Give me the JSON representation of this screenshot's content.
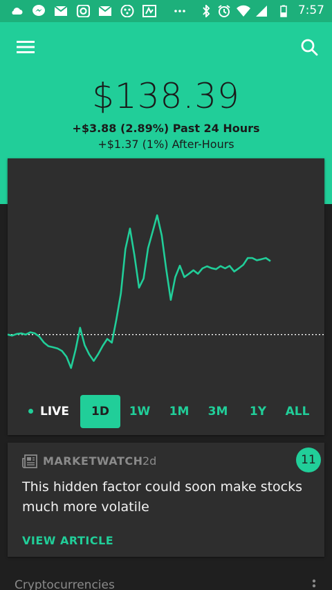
{
  "status_bar": {
    "time": "7:57",
    "icons": [
      "cloud-icon",
      "messenger-icon",
      "mail-icon",
      "instagram-icon",
      "mail-icon",
      "app-icon",
      "app2-icon",
      "more-notifications-icon",
      "bluetooth-icon",
      "alarm-icon",
      "wifi-icon",
      "signal-icon",
      "battery-icon"
    ]
  },
  "header": {
    "price": "$138.39",
    "change": "+$3.88 (2.89%) Past 24 Hours",
    "after_hours": "+$1.37 (1%) After-Hours"
  },
  "chart_data": {
    "type": "line",
    "title": "",
    "xlabel": "",
    "ylabel": "",
    "baseline": 134.51,
    "ylim": [
      132.0,
      142.0
    ],
    "x": [
      0,
      1,
      2,
      3,
      4,
      5,
      6,
      7,
      8,
      9,
      10,
      11,
      12,
      13,
      14,
      15,
      16,
      17,
      18,
      19,
      20,
      21,
      22,
      23,
      24,
      25,
      26,
      27,
      28,
      29,
      30,
      31,
      32,
      33,
      34,
      35,
      36,
      37,
      38,
      39,
      40,
      41,
      42,
      43,
      44,
      45,
      46,
      47,
      48,
      49,
      50,
      51,
      52,
      53,
      54,
      55,
      56,
      57,
      58,
      59,
      60,
      61,
      62,
      63,
      64,
      65,
      66,
      67,
      68,
      69,
      70,
      71,
      72,
      73,
      74,
      75,
      76,
      77,
      78,
      79,
      80,
      81,
      82,
      83,
      84,
      85,
      86,
      87,
      88,
      89,
      90,
      91,
      92,
      93,
      94,
      95,
      96,
      97,
      98,
      99,
      100
    ],
    "values": [
      134.51,
      134.46,
      134.54,
      134.57,
      134.51,
      134.62,
      134.57,
      134.41,
      134.13,
      133.95,
      133.9,
      133.84,
      133.72,
      133.44,
      132.9,
      133.78,
      134.84,
      134.0,
      133.56,
      133.24,
      133.57,
      133.97,
      134.3,
      134.12,
      135.23,
      136.5,
      138.63,
      139.62,
      138.32,
      136.77,
      137.21,
      138.68,
      139.47,
      140.26,
      139.29,
      137.66,
      136.18,
      137.28,
      137.83,
      137.28,
      137.44,
      137.61,
      137.44,
      137.7,
      137.8,
      137.71,
      137.66,
      137.81,
      137.7,
      137.82,
      137.55,
      137.7,
      137.87,
      138.2,
      138.2,
      138.09,
      138.14,
      138.2,
      138.05
    ],
    "color": "#21ce99",
    "baseline_color": "#ffffff"
  },
  "ranges": {
    "live_label": "LIVE",
    "items": [
      {
        "label": "1D",
        "active": true
      },
      {
        "label": "1W",
        "active": false
      },
      {
        "label": "1M",
        "active": false
      },
      {
        "label": "3M",
        "active": false
      },
      {
        "label": "1Y",
        "active": false
      },
      {
        "label": "ALL",
        "active": false
      }
    ]
  },
  "news": {
    "source": "MARKETWATCH",
    "age": "2d",
    "title": "This hidden factor could soon make stocks much more volatile",
    "action": "VIEW ARTICLE",
    "count": "11"
  },
  "next_section": {
    "title": "Cryptocurrencies"
  },
  "colors": {
    "accent": "#21ce99",
    "background": "#1f1f1f",
    "card": "#2e2e2e"
  }
}
